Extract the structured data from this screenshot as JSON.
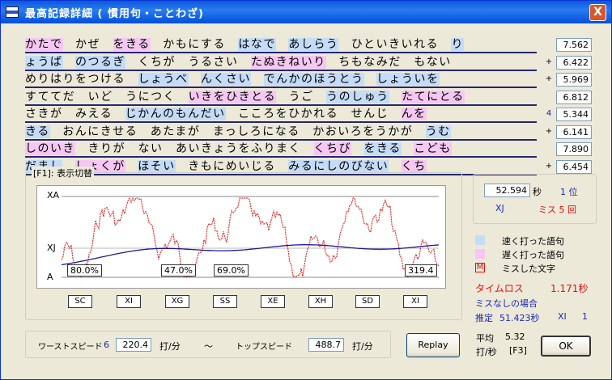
{
  "window": {
    "title": "最高記録詳細 ( 慣用句・ことわざ)",
    "close": "X"
  },
  "lines": [
    {
      "segments": [
        {
          "t": "かたで",
          "c": "slow"
        },
        {
          "t": "かぜ"
        },
        {
          "t": "をきる",
          "c": "slow"
        },
        {
          "t": "かもにする"
        },
        {
          "t": "はなで",
          "c": "fast"
        },
        {
          "t": "あしらう",
          "c": "fast"
        },
        {
          "t": "ひといきいれる"
        },
        {
          "t": "り",
          "c": "fast"
        }
      ],
      "score": "7.562",
      "mark": ""
    },
    {
      "segments": [
        {
          "t": "ょうば",
          "c": "fast"
        },
        {
          "t": "のつるぎ",
          "c": "fast"
        },
        {
          "t": "くちが"
        },
        {
          "t": "うるさい"
        },
        {
          "t": "たぬきねいり",
          "c": "slow"
        },
        {
          "t": "ちもなみだ"
        },
        {
          "t": "もない"
        }
      ],
      "score": "6.422",
      "mark": "+"
    },
    {
      "segments": [
        {
          "t": "めりはりをつける"
        },
        {
          "t": "しょうべ",
          "c": "fast"
        },
        {
          "t": "んくさい",
          "c": "fast"
        },
        {
          "t": "でんかのほうとう",
          "c": "fast"
        },
        {
          "t": "しょういを",
          "c": "fast"
        }
      ],
      "score": "5.969",
      "mark": "+"
    },
    {
      "segments": [
        {
          "t": "すててだ"
        },
        {
          "t": "いど"
        },
        {
          "t": "うにつく"
        },
        {
          "t": "いきをひきとる",
          "c": "slow"
        },
        {
          "t": "うご"
        },
        {
          "t": "うのしゅう",
          "c": "fast"
        },
        {
          "t": "たてにとる",
          "c": "slow"
        }
      ],
      "score": "6.812",
      "mark": ""
    },
    {
      "segments": [
        {
          "t": "さきが"
        },
        {
          "t": "みえる"
        },
        {
          "t": "じかんのもんだい",
          "c": "fast"
        },
        {
          "t": "こころをひかれる"
        },
        {
          "t": "せんじ"
        },
        {
          "t": "んを",
          "c": "slow"
        }
      ],
      "score": "5.344",
      "mark": "4"
    },
    {
      "segments": [
        {
          "t": "きる",
          "c": "fast"
        },
        {
          "t": "おんにきせる"
        },
        {
          "t": "あたまが"
        },
        {
          "t": "まっしろになる"
        },
        {
          "t": "かおいろをうかが"
        },
        {
          "t": "うむ",
          "c": "fast"
        }
      ],
      "score": "6.141",
      "mark": "+"
    },
    {
      "segments": [
        {
          "t": "しのいき",
          "c": "slow"
        },
        {
          "t": "きりが"
        },
        {
          "t": "ない"
        },
        {
          "t": "あいきょうをふりまく"
        },
        {
          "t": "くちび",
          "c": "slow"
        },
        {
          "t": "をきる",
          "c": "fast"
        },
        {
          "t": "こども",
          "c": "slow"
        }
      ],
      "score": "7.890",
      "mark": ""
    },
    {
      "segments": [
        {
          "t": "だまし",
          "c": "fast"
        },
        {
          "t": "しょくが",
          "c": "slow"
        },
        {
          "t": "ほそい",
          "c": "fast"
        },
        {
          "t": "きもにめいじる"
        },
        {
          "t": "みるにしのびない",
          "c": "fast"
        },
        {
          "t": "くち",
          "c": "slow"
        }
      ],
      "score": "6.454",
      "mark": "+"
    }
  ],
  "graph": {
    "section_label": "[F1]: 表示切替",
    "y_labels": [
      "XA",
      "XJ",
      "A"
    ],
    "percents": [
      "80.0%",
      "47.0%",
      "69.0%",
      "319.4"
    ],
    "section_ranks": [
      "SC",
      "XI",
      "XG",
      "SS",
      "XE",
      "XH",
      "SD",
      "XI"
    ]
  },
  "result": {
    "time": "52.594",
    "time_unit": "秒",
    "rank": "1 位",
    "grade": "XJ",
    "miss": "ミス 5 回"
  },
  "legend": {
    "fast": "速く打った語句",
    "slow": "遅く打った語句",
    "miss_mark": "M",
    "miss": "ミスした文字",
    "fast_color": "#c4dcf7",
    "slow_color": "#f5c7f2"
  },
  "timeloss": {
    "label": "タイムロス",
    "value": "1.171秒"
  },
  "nomiss": {
    "label": "ミスなしの場合",
    "estimate_label": "推定",
    "estimate_value": "51.423秒",
    "estimate_grade": "XI",
    "estimate_rank": "1"
  },
  "speed": {
    "worst_label": "ワーストスピード",
    "worst_num": "6",
    "worst_value": "220.4",
    "unit": "打/分",
    "tilde": "〜",
    "top_label": "トップスピード",
    "top_value": "488.7",
    "unit2": "打/分"
  },
  "avg": {
    "label": "平均",
    "value": "5.32",
    "unit": "打/秒",
    "key": "[F3]"
  },
  "buttons": {
    "replay": "Replay",
    "ok": "OK"
  }
}
